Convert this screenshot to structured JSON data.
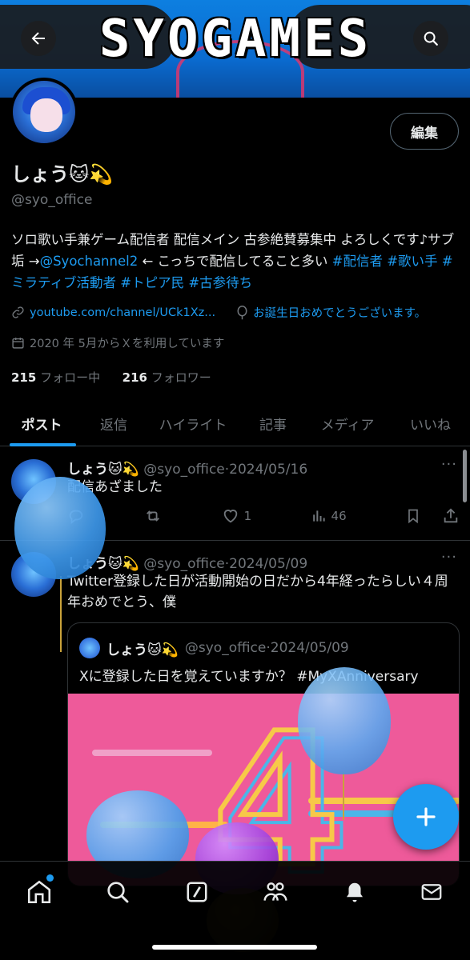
{
  "banner": {
    "logo_text": "SYOGAMES"
  },
  "profile": {
    "display_name": "しょう🐱💫",
    "handle": "@syo_office",
    "edit_label": "編集",
    "bio_text_1": "ソロ歌い手兼ゲーム配信者 配信メイン 古参絶賛募集中 よろしくです♪サブ垢 →",
    "bio_mention": "@Syochannel2",
    "bio_text_2": " ← こっちで配信してること多い ",
    "bio_hashtags": "#配信者 #歌い手 #ミラティブ活動者 #トピア民 #古参待ち",
    "website": "youtube.com/channel/UCk1Xz...",
    "birthday": "お誕生日おめでとうございます。",
    "joined": "2020 年 5月からＸを利用しています",
    "following_count": "215",
    "following_label": "フォロー中",
    "followers_count": "216",
    "followers_label": "フォロワー"
  },
  "tabs": [
    "ポスト",
    "返信",
    "ハイライト",
    "記事",
    "メディア",
    "いいね"
  ],
  "posts": [
    {
      "name": "しょう🐱💫",
      "handle": "@syo_office",
      "sep": "·",
      "date": "2024/05/16",
      "text": "配信あざました",
      "likes": "1",
      "views": "46"
    },
    {
      "name": "しょう🐱💫",
      "handle": "@syo_office",
      "sep": "·",
      "date": "2024/05/09",
      "text": "Twitter登録した日が活動開始の日だから4年経ったらしい４周年おめでとう、僕",
      "quote": {
        "name": "しょう🐱💫",
        "handle": "@syo_office",
        "sep": "·",
        "date": "2024/05/09",
        "text": "Xに登録した日を覚えていますか？ #MyXAnniversary",
        "image_numeral": "4"
      }
    }
  ],
  "icons": {
    "back": "back-arrow-icon",
    "search": "search-icon",
    "link": "link-icon",
    "balloon": "balloon-icon",
    "calendar": "calendar-icon",
    "compose": "plus-icon"
  },
  "colors": {
    "accent": "#1d9bf0",
    "muted": "#71767b",
    "background": "#000000"
  }
}
